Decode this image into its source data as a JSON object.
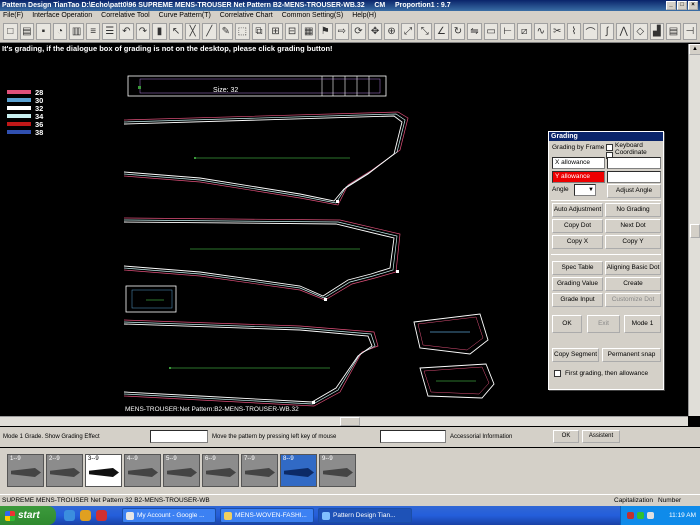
{
  "window": {
    "title": "Pattern Design TianTao D:\\Echo\\patt0\\96 SUPREME MENS-TROUSER Net Pattern B2-MENS-TROUSER-WB.32",
    "units": "CM",
    "proportion": "Proportion1 : 9.7",
    "ctrl_min": "_",
    "ctrl_max": "□",
    "ctrl_close": "×"
  },
  "menu": [
    "File(F)",
    "Interface Operation",
    "Correlative Tool",
    "Curve Pattern(T)",
    "Correlative Chart",
    "Common Setting(S)",
    "Help(H)"
  ],
  "toolbar_icons": [
    "new-icon",
    "open-icon",
    "save-icon",
    "digitize-icon",
    "import-icon",
    "stack-icon",
    "list-icon",
    "undo-icon",
    "redo-icon",
    "bars-icon",
    "pointer-icon",
    "cross-icon",
    "line-icon",
    "pencil-icon",
    "select-icon",
    "copy-icon",
    "paste-icon",
    "split-icon",
    "grid-icon",
    "flag-icon",
    "right-arrow-icon",
    "lasso-icon",
    "move-icon",
    "zoom-icon",
    "fit-icon",
    "expand-icon",
    "angle-icon",
    "rotate-icon",
    "mirror-icon",
    "rect-icon",
    "measure-icon",
    "grade-icon",
    "stitch-icon",
    "scissors-icon",
    "notch-icon",
    "arc-icon",
    "curve-icon",
    "pleat-icon",
    "dart-icon",
    "chart-icon",
    "grade-table-icon",
    "ruler-icon"
  ],
  "toolbar_glyphs": [
    "□",
    "▤",
    "▪",
    "◔",
    "▥",
    "≡",
    "☰",
    "↶",
    "↷",
    "▮",
    "↖",
    "╳",
    "╱",
    "✎",
    "⬚",
    "⧉",
    "⊞",
    "⊟",
    "▦",
    "⚑",
    "⇨",
    "⟳",
    "✥",
    "⊕",
    "⤢",
    "⤡",
    "∠",
    "↻",
    "⇋",
    "▭",
    "⊢",
    "⧄",
    "∿",
    "✂",
    "⌇",
    "⌒",
    "∫",
    "⋀",
    "◇",
    "▟",
    "▤",
    "⊣"
  ],
  "notice": "It's grading, if the dialogue box of grading is not on the desktop, please click grading button!",
  "legend": [
    {
      "label": "28",
      "color": "#e0507a"
    },
    {
      "label": "30",
      "color": "#5aa0d0"
    },
    {
      "label": "32",
      "color": "#ffffff"
    },
    {
      "label": "34",
      "color": "#c8f0f0"
    },
    {
      "label": "36",
      "color": "#c01818"
    },
    {
      "label": "38",
      "color": "#3050b0"
    }
  ],
  "size_label": "Size: 32",
  "pattern_label": "MENS-TROUSER:Net Pattern:B2-MENS-TROUSER-WB.32",
  "dialog": {
    "title": "Grading",
    "grading_by_frame": "Grading by Frame",
    "keyboard_coordinate": "Keyboard Coordinate",
    "x_allowance": "X allowance",
    "y_allowance": "Y allowance",
    "angle": "Angle",
    "angle_value": "",
    "adjust_angle": "Adjust Angle",
    "auto_adjustment": "Auto Adjustment",
    "no_grading": "No Grading",
    "copy_dot": "Copy Dot",
    "next_dot": "Next Dot",
    "copy_x": "Copy X",
    "copy_y": "Copy Y",
    "spec_table": "Spec Table",
    "aligning_basic_dot": "Aligning Basic Dot",
    "grading_value": "Grading Value",
    "create": "Create",
    "grade_input": "Grade Input",
    "customize_dot": "Customize Dot",
    "ok": "OK",
    "exit": "Exit",
    "mode1": "Mode 1",
    "copy_segment": "Copy Segment",
    "permanent_snap": "Permanent snap",
    "first_grading": "First grading, then allowance"
  },
  "status": {
    "mode_text": "Mode 1 Grade. Show Grading Effect",
    "move_text": "Move the pattern by pressing left key of mouse",
    "accessorial": "Accessorial Information",
    "ok": "OK",
    "assistant": "Assistent"
  },
  "thumbnails": [
    "1--9",
    "2--9",
    "3--9",
    "4--9",
    "5--9",
    "6--9",
    "7--9",
    "8--9",
    "9--9"
  ],
  "bottom_status": {
    "left": "SUPREME  MENS-TROUSER  Net Pattern  32  B2-MENS-TROUSER-WB",
    "caps": "Capitalization",
    "num": "Number"
  },
  "taskbar": {
    "start": "start",
    "tasks": [
      "My Account - Google ...",
      "MENS-WOVEN-FASHI...",
      "Pattern Design Tian..."
    ],
    "time": "11:19 AM"
  },
  "accent_colors": {
    "grade_green": "#3a9a3a",
    "outline": "#ffffff",
    "selected": "#316ac5"
  }
}
